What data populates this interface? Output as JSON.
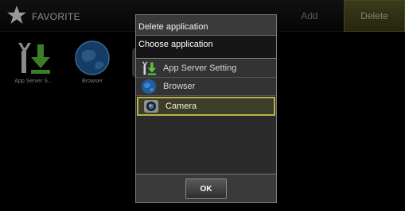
{
  "launcher": {
    "title": "FAVORITE",
    "add_label": "Add",
    "delete_label": "Delete",
    "apps": [
      {
        "label": "App Server S...",
        "icon": "wrench-download-icon"
      },
      {
        "label": "Browser",
        "icon": "globe-icon"
      }
    ]
  },
  "dialog": {
    "title": "Delete application",
    "subtitle": "Choose application",
    "items": [
      {
        "label": "App Server Setting",
        "icon": "wrench-download-icon",
        "selected": false
      },
      {
        "label": "Browser",
        "icon": "globe-icon",
        "selected": false
      },
      {
        "label": "Camera",
        "icon": "camera-icon",
        "selected": true
      }
    ],
    "ok_label": "OK"
  },
  "colors": {
    "selection_border": "#b8b24a",
    "delete_button_bg": "#4a4820",
    "background": "#000000"
  }
}
